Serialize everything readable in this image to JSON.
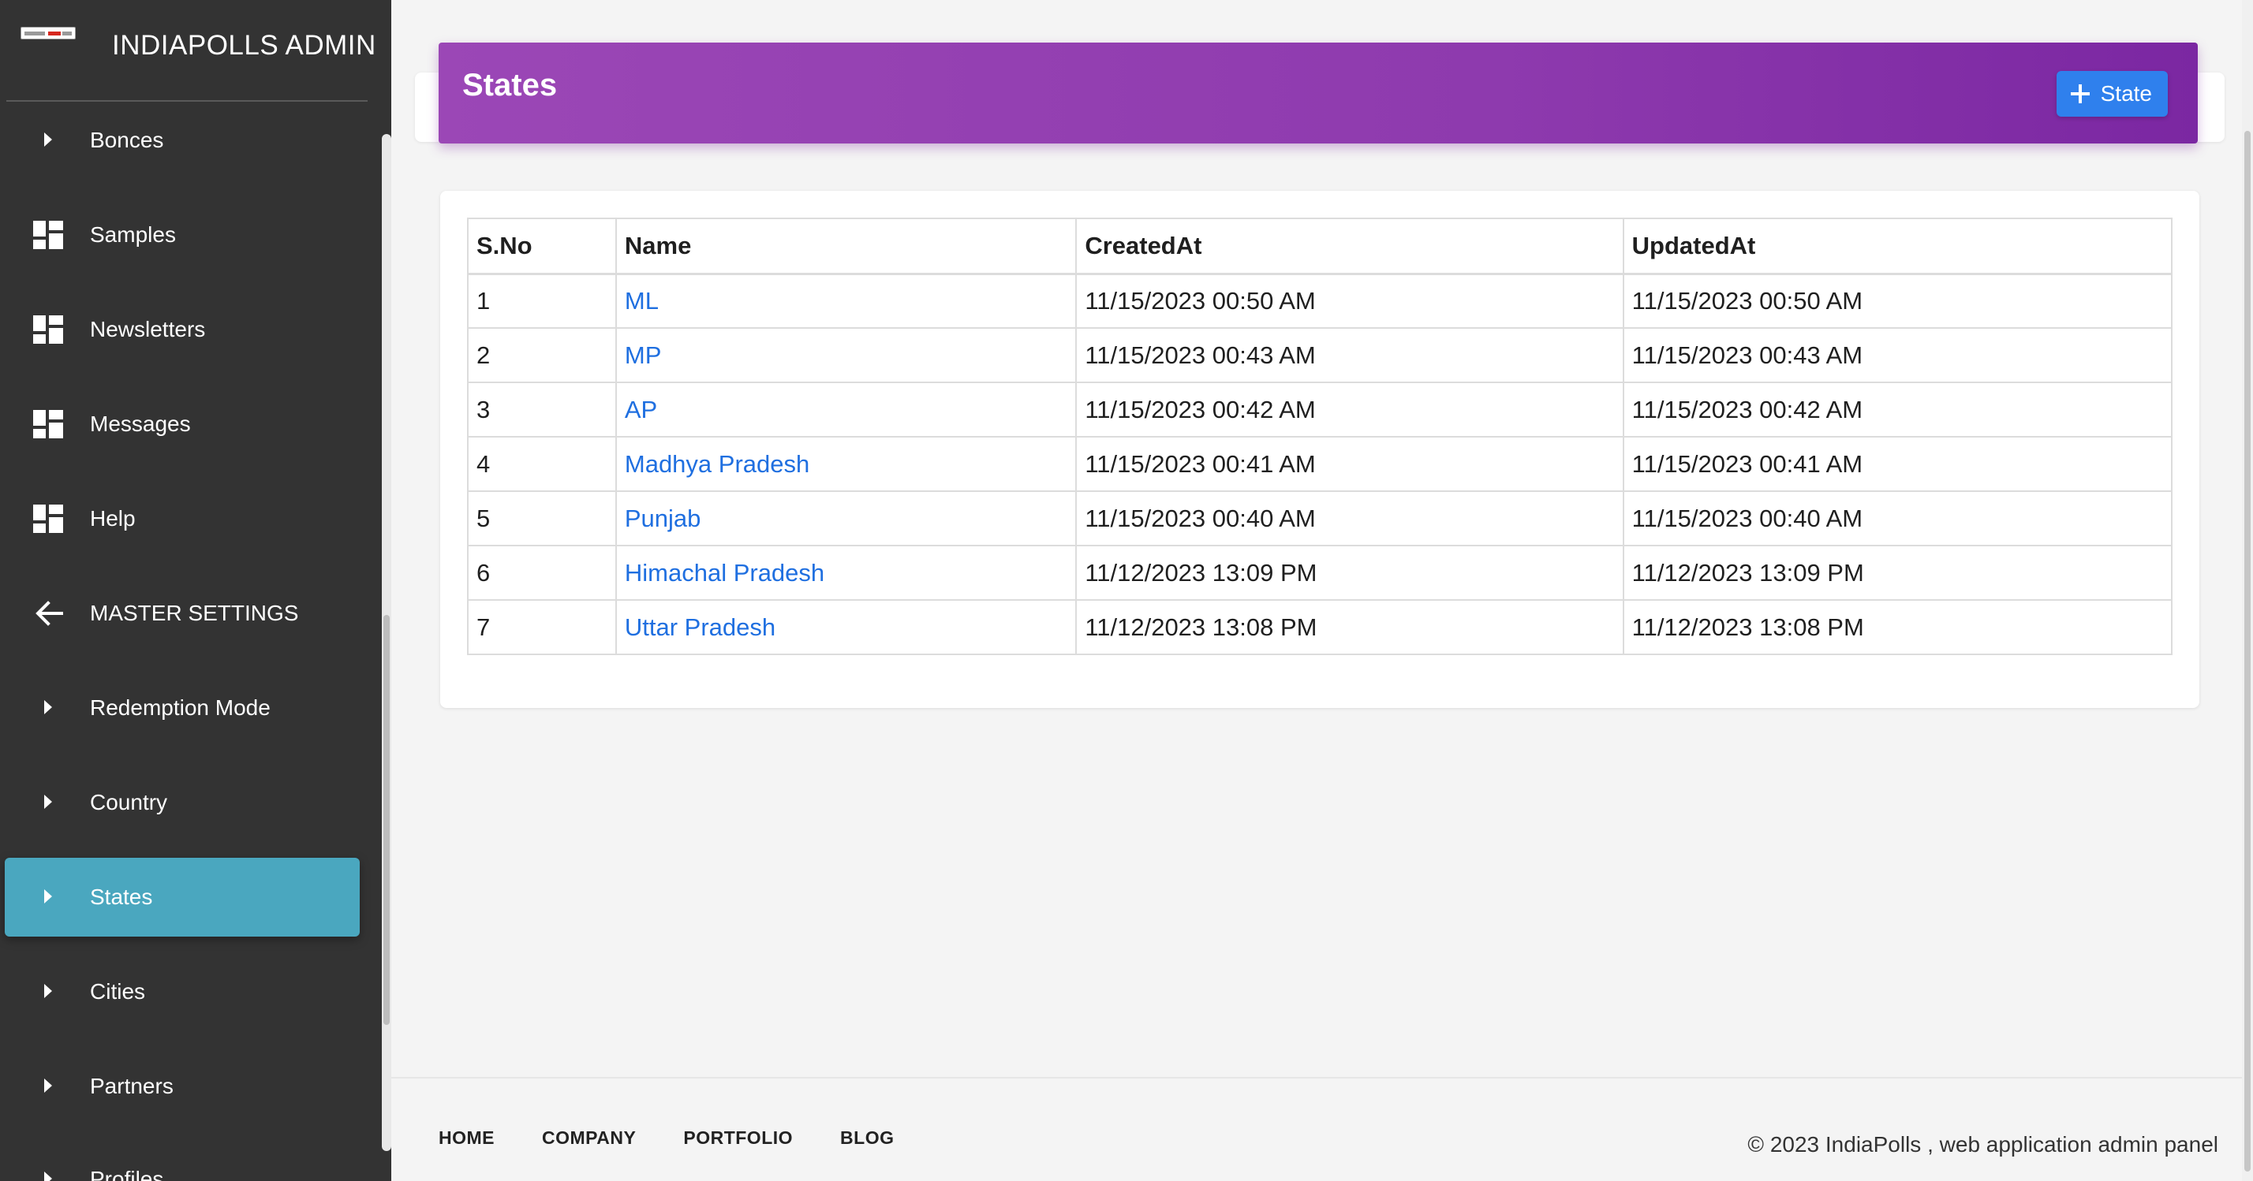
{
  "app": {
    "title": "INDIAPOLLS ADMIN"
  },
  "sidebar": {
    "items": [
      {
        "label": "Bonces",
        "icon": "caret-right-icon"
      },
      {
        "label": "Samples",
        "icon": "dashboard-icon"
      },
      {
        "label": "Newsletters",
        "icon": "dashboard-icon"
      },
      {
        "label": "Messages",
        "icon": "dashboard-icon"
      },
      {
        "label": "Help",
        "icon": "dashboard-icon"
      },
      {
        "label": "MASTER SETTINGS",
        "icon": "arrow-left-icon"
      },
      {
        "label": "Redemption Mode",
        "icon": "caret-right-icon"
      },
      {
        "label": "Country",
        "icon": "caret-right-icon"
      },
      {
        "label": "States",
        "icon": "caret-right-icon",
        "active": true
      },
      {
        "label": "Cities",
        "icon": "caret-right-icon"
      },
      {
        "label": "Partners",
        "icon": "caret-right-icon"
      },
      {
        "label": "Profiles",
        "icon": "caret-right-icon"
      }
    ],
    "active_color": "#4aa7bf",
    "background": "#333333"
  },
  "header": {
    "title": "States",
    "add_button_label": "State",
    "gradient_colors": [
      "#9b47b6",
      "#7b27a2"
    ],
    "button_color": "#2f80ed"
  },
  "table": {
    "columns": [
      "S.No",
      "Name",
      "CreatedAt",
      "UpdatedAt"
    ],
    "rows": [
      {
        "sno": "1",
        "name": "ML",
        "created": "11/15/2023 00:50 AM",
        "updated": "11/15/2023 00:50 AM"
      },
      {
        "sno": "2",
        "name": "MP",
        "created": "11/15/2023 00:43 AM",
        "updated": "11/15/2023 00:43 AM"
      },
      {
        "sno": "3",
        "name": "AP",
        "created": "11/15/2023 00:42 AM",
        "updated": "11/15/2023 00:42 AM"
      },
      {
        "sno": "4",
        "name": "Madhya Pradesh",
        "created": "11/15/2023 00:41 AM",
        "updated": "11/15/2023 00:41 AM"
      },
      {
        "sno": "5",
        "name": "Punjab",
        "created": "11/15/2023 00:40 AM",
        "updated": "11/15/2023 00:40 AM"
      },
      {
        "sno": "6",
        "name": "Himachal Pradesh",
        "created": "11/12/2023 13:09 PM",
        "updated": "11/12/2023 13:09 PM"
      },
      {
        "sno": "7",
        "name": "Uttar Pradesh",
        "created": "11/12/2023 13:08 PM",
        "updated": "11/12/2023 13:08 PM"
      }
    ],
    "link_color": "#1f6fe0"
  },
  "footer": {
    "links": [
      "HOME",
      "COMPANY",
      "PORTFOLIO",
      "BLOG"
    ],
    "copyright": "© 2023 IndiaPolls , web application admin panel"
  }
}
